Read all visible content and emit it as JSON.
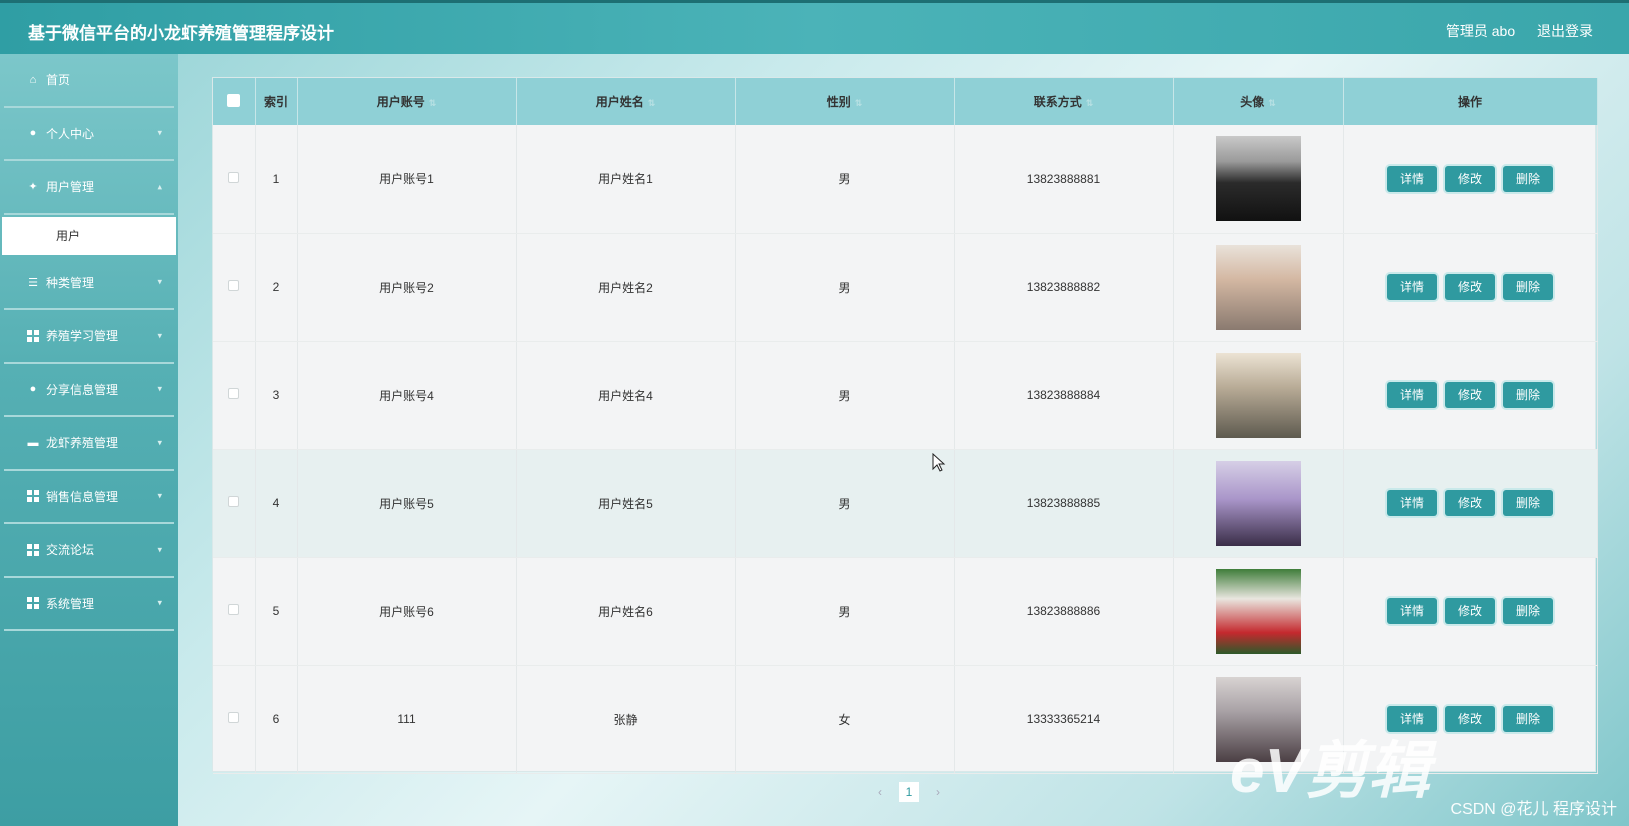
{
  "header": {
    "title": "基于微信平台的小龙虾养殖管理程序设计",
    "user_label": "管理员 abo",
    "logout_label": "退出登录"
  },
  "sidebar": {
    "items": [
      {
        "label": "首页",
        "icon": "home-icon"
      },
      {
        "label": "个人中心",
        "icon": "user-icon"
      },
      {
        "label": "用户管理",
        "icon": "users-icon"
      },
      {
        "label": "种类管理",
        "icon": "sliders-icon"
      },
      {
        "label": "养殖学习管理",
        "icon": "grid-icon"
      },
      {
        "label": "分享信息管理",
        "icon": "pin-icon"
      },
      {
        "label": "龙虾养殖管理",
        "icon": "chat-icon"
      },
      {
        "label": "销售信息管理",
        "icon": "grid-icon"
      },
      {
        "label": "交流论坛",
        "icon": "grid-icon"
      },
      {
        "label": "系统管理",
        "icon": "grid-icon"
      }
    ],
    "submenu": {
      "label": "用户"
    }
  },
  "table": {
    "headers": [
      "索引",
      "用户账号",
      "用户姓名",
      "性别",
      "联系方式",
      "头像",
      "操作"
    ],
    "rows": [
      {
        "index": "1",
        "account": "用户账号1",
        "name": "用户姓名1",
        "gender": "男",
        "phone": "13823888881"
      },
      {
        "index": "2",
        "account": "用户账号2",
        "name": "用户姓名2",
        "gender": "男",
        "phone": "13823888882"
      },
      {
        "index": "3",
        "account": "用户账号4",
        "name": "用户姓名4",
        "gender": "男",
        "phone": "13823888884"
      },
      {
        "index": "4",
        "account": "用户账号5",
        "name": "用户姓名5",
        "gender": "男",
        "phone": "13823888885"
      },
      {
        "index": "5",
        "account": "用户账号6",
        "name": "用户姓名6",
        "gender": "男",
        "phone": "13823888886"
      },
      {
        "index": "6",
        "account": "111",
        "name": "张静",
        "gender": "女",
        "phone": "13333365214"
      }
    ],
    "actions": {
      "detail": "详情",
      "edit": "修改",
      "delete": "删除"
    }
  },
  "pagination": {
    "current": "1",
    "prev": "‹",
    "next": "›"
  },
  "watermark": {
    "text": "eV剪辑",
    "credit": "CSDN @花儿  程序设计"
  },
  "colors": {
    "accent": "#2f9aa0",
    "header_bg": "#8fd0d6"
  }
}
